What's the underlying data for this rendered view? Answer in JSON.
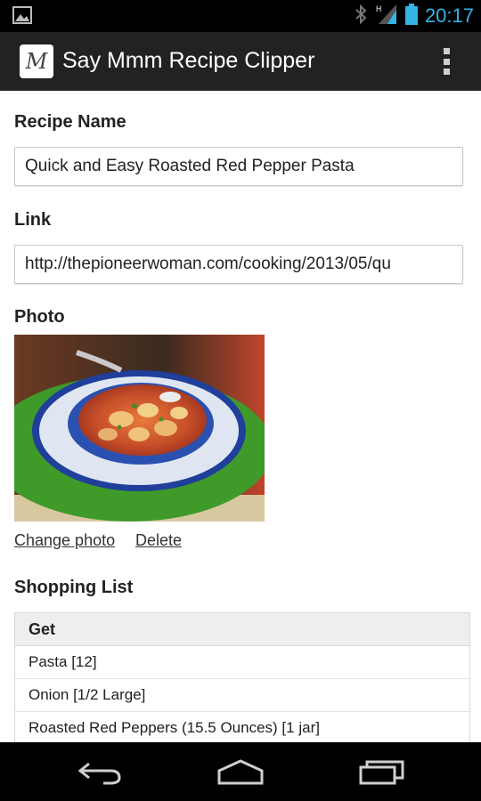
{
  "status_bar": {
    "time": "20:17",
    "icons": [
      "image-icon",
      "bluetooth-icon",
      "signal-icon",
      "battery-icon"
    ]
  },
  "action_bar": {
    "app_icon_letter": "M",
    "title": "Say Mmm Recipe Clipper",
    "menu_icon": "overflow-menu-icon"
  },
  "form": {
    "recipe_name_label": "Recipe Name",
    "recipe_name_value": "Quick and Easy Roasted Red Pepper Pasta",
    "link_label": "Link",
    "link_value": "http://thepioneerwoman.com/cooking/2013/05/qu",
    "photo_label": "Photo",
    "change_photo": "Change photo",
    "delete": "Delete"
  },
  "shopping_list": {
    "label": "Shopping List",
    "column_header": "Get",
    "items": [
      "Pasta [12]",
      "Onion [1/2 Large]",
      "Roasted Red Peppers (15.5 Ounces) [1 jar]"
    ]
  },
  "nav_bar": {
    "icons": [
      "back-icon",
      "home-icon",
      "recent-apps-icon"
    ]
  },
  "colors": {
    "accent": "#33b5e5",
    "action_bar": "#222222",
    "status_bar": "#000000"
  }
}
